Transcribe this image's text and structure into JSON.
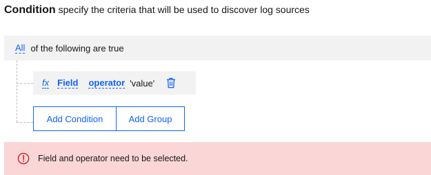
{
  "header": {
    "title": "Condition",
    "description": "specify the criteria that will be used to discover log sources"
  },
  "group": {
    "match_label": "All",
    "match_suffix": "of the following are true"
  },
  "condition": {
    "fx_label": "fx",
    "field_label": "Field",
    "operator_label": "operator",
    "value_label": "'value'",
    "delete_icon": "trash-icon"
  },
  "actions": {
    "add_condition_label": "Add Condition",
    "add_group_label": "Add Group"
  },
  "notification": {
    "icon": "error-icon",
    "message": "Field and operator need to be selected.",
    "kind": "error"
  },
  "colors": {
    "accent": "#0f62fe",
    "error": "#da1e28",
    "error_background": "#fad6d7",
    "panel_background": "#f2f2f2"
  }
}
